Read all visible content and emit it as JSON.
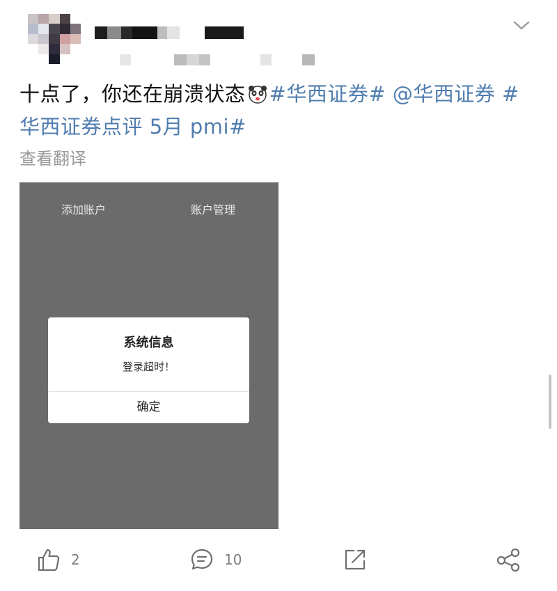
{
  "post": {
    "text_plain": "十点了，你还在崩溃状态",
    "emoji": "panda-face-emoji",
    "tag1": "#华西证券#",
    "mention": "@华西证券",
    "tag2_part1": "#",
    "tag2_part2": "华西证券点评 5月 pmi#"
  },
  "translate_label": "查看翻译",
  "screenshot": {
    "tab_left": "添加账户",
    "tab_right": "账户管理",
    "dialog": {
      "title": "系统信息",
      "message": "登录超时！",
      "confirm_label": "确定"
    }
  },
  "actions": {
    "like_count": "2",
    "comment_count": "10"
  },
  "icons": [
    "chevron-down-icon",
    "thumbs-up-icon",
    "comment-icon",
    "repost-icon",
    "share-icon"
  ],
  "colors": {
    "tag_link": "#507daf",
    "muted": "#9a9a9a",
    "screenshot_bg": "#6b6b6b"
  }
}
